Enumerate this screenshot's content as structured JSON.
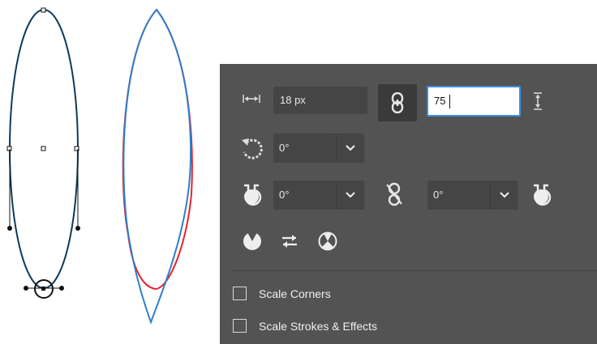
{
  "width_field": {
    "value": "18 px",
    "icon": "width-arrows-icon"
  },
  "link_button": {
    "icon": "link-chain-icon"
  },
  "height_field": {
    "value": "75",
    "icon": "height-arrows-icon"
  },
  "rotate": {
    "value": "0°",
    "icon": "rotate-icon"
  },
  "corner_left": {
    "value": "0°",
    "icon": "corner-angle-left-icon"
  },
  "corner_link": {
    "icon": "unlink-chain-icon"
  },
  "corner_right": {
    "value": "0°",
    "icon": "corner-angle-right-icon"
  },
  "pie_buttons": [
    "pie-icon",
    "swap-arrows-icon",
    "pie-invert-icon"
  ],
  "options": [
    {
      "label": "Scale Corners",
      "checked": false
    },
    {
      "label": "Scale Strokes & Effects",
      "checked": false
    }
  ],
  "colors": {
    "panel": "#535353",
    "field": "#454545",
    "path_outline": "#0e3a5a",
    "path_blue": "#2f7fc8",
    "path_red": "#e8222b",
    "focus": "#3a8ee6"
  }
}
